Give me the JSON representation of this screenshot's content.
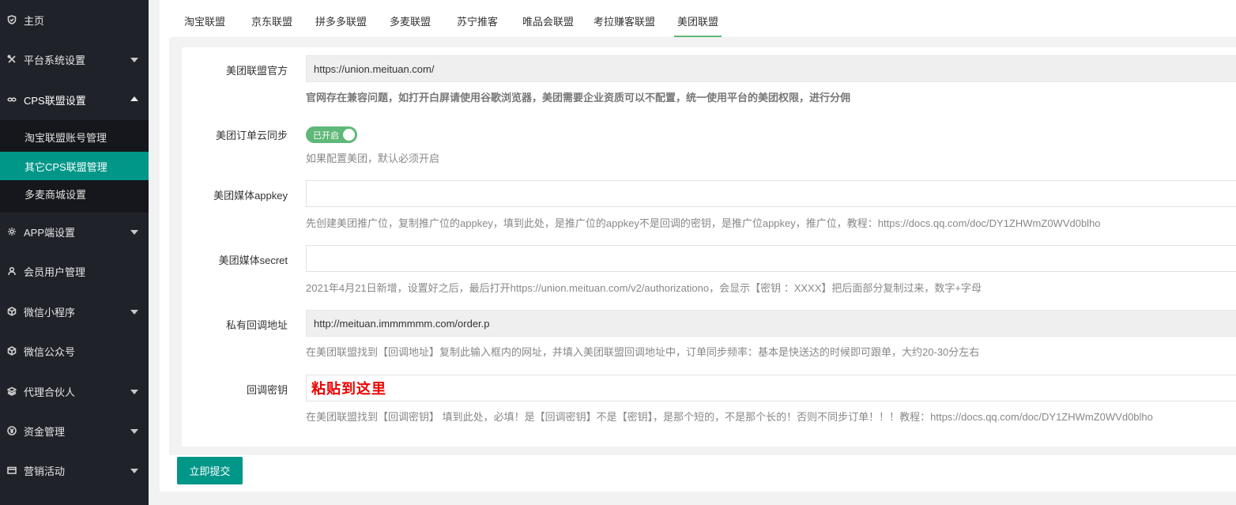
{
  "sidebar": {
    "items": [
      {
        "label": "主页",
        "icon": "shield-icon"
      },
      {
        "label": "平台系统设置",
        "icon": "tools-icon"
      },
      {
        "label": "CPS联盟设置",
        "icon": "link-icon"
      },
      {
        "label": "APP端设置",
        "icon": "gear-icon"
      },
      {
        "label": "会员用户管理",
        "icon": "user-icon"
      },
      {
        "label": "微信小程序",
        "icon": "cube-icon"
      },
      {
        "label": "微信公众号",
        "icon": "cube-icon"
      },
      {
        "label": "代理合伙人",
        "icon": "layers-icon"
      },
      {
        "label": "资金管理",
        "icon": "yen-icon"
      },
      {
        "label": "营销活动",
        "icon": "card-icon"
      }
    ],
    "subitems": [
      {
        "label": "淘宝联盟账号管理"
      },
      {
        "label": "其它CPS联盟管理"
      },
      {
        "label": "多麦商城设置"
      }
    ]
  },
  "tabs": [
    {
      "label": "淘宝联盟"
    },
    {
      "label": "京东联盟"
    },
    {
      "label": "拼多多联盟"
    },
    {
      "label": "多麦联盟"
    },
    {
      "label": "苏宁推客"
    },
    {
      "label": "唯品会联盟"
    },
    {
      "label": "考拉赚客联盟"
    },
    {
      "label": "美团联盟"
    }
  ],
  "form": {
    "official": {
      "label": "美团联盟官方",
      "value": "https://union.meituan.com/",
      "tip": "官网存在兼容问题，如打开白屏请使用谷歌浏览器，美团需要企业资质可以不配置，统一使用平台的美团权限，进行分佣"
    },
    "sync": {
      "label": "美团订单云同步",
      "switch_text": "已开启",
      "tip": "如果配置美团，默认必须开启"
    },
    "appkey": {
      "label": "美团媒体appkey",
      "value": "",
      "tip": "先创建美团推广位，复制推广位的appkey，填到此处，是推广位的appkey不是回调的密钥，是推广位appkey，推广位，教程：https://docs.qq.com/doc/DY1ZHWmZ0WVd0blho"
    },
    "secret": {
      "label": "美团媒体secret",
      "value": "",
      "tip": "2021年4月21日新增，设置好之后，最后打开https://union.meituan.com/v2/authorizationo，会显示【密钥 ：XXXX】把后面部分复制过来，数字+字母"
    },
    "callback_url": {
      "label": "私有回调地址",
      "value": "http://meituan.immmmmm.com/order.p",
      "tip": "在美团联盟找到【回调地址】复制此输入框内的网址，并填入美团联盟回调地址中，订单同步频率：基本是快送达的时候即可跟单，大约20-30分左右"
    },
    "callback_secret": {
      "label": "回调密钥",
      "value": "粘贴到这里",
      "tip": "在美团联盟找到【回调密钥】 填到此处，必填！是【回调密钥】不是【密钥】，是那个短的，不是那个长的！否则不同步订单！！！教程：https://docs.qq.com/doc/DY1ZHWmZ0WVd0blho"
    }
  },
  "submit_label": "立即提交",
  "colors": {
    "accent": "#009688",
    "switch": "#5fb878",
    "sidebar": "#20222a",
    "highlight_text": "#ee0000"
  }
}
